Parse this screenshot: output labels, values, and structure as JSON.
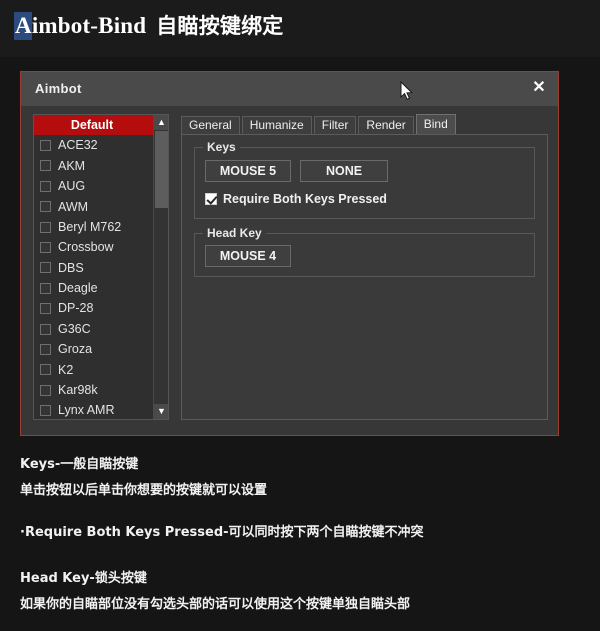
{
  "page": {
    "title_en_lead": "A",
    "title_en_rest": "imbot-Bind",
    "title_cn": "自瞄按键绑定"
  },
  "dialog": {
    "title": "Aimbot",
    "close_icon": "✕",
    "accent_border": "#9c3d34",
    "selected_color": "#b50d0d"
  },
  "weapon_list": {
    "scroll_up_icon": "▲",
    "scroll_down_icon": "▼",
    "items": [
      {
        "label": "Default",
        "selected": true,
        "checked": false
      },
      {
        "label": "ACE32",
        "selected": false,
        "checked": false
      },
      {
        "label": "AKM",
        "selected": false,
        "checked": false
      },
      {
        "label": "AUG",
        "selected": false,
        "checked": false
      },
      {
        "label": "AWM",
        "selected": false,
        "checked": false
      },
      {
        "label": "Beryl M762",
        "selected": false,
        "checked": false
      },
      {
        "label": "Crossbow",
        "selected": false,
        "checked": false
      },
      {
        "label": "DBS",
        "selected": false,
        "checked": false
      },
      {
        "label": "Deagle",
        "selected": false,
        "checked": false
      },
      {
        "label": "DP-28",
        "selected": false,
        "checked": false
      },
      {
        "label": "G36C",
        "selected": false,
        "checked": false
      },
      {
        "label": "Groza",
        "selected": false,
        "checked": false
      },
      {
        "label": "K2",
        "selected": false,
        "checked": false
      },
      {
        "label": "Kar98k",
        "selected": false,
        "checked": false
      },
      {
        "label": "Lynx AMR",
        "selected": false,
        "checked": false
      }
    ]
  },
  "tabs": [
    {
      "label": "General",
      "active": false
    },
    {
      "label": "Humanize",
      "active": false
    },
    {
      "label": "Filter",
      "active": false
    },
    {
      "label": "Render",
      "active": false
    },
    {
      "label": "Bind",
      "active": true
    }
  ],
  "keys_group": {
    "title": "Keys",
    "primary_key": "MOUSE 5",
    "secondary_key": "NONE",
    "require_both_label": "Require Both Keys Pressed",
    "require_both_checked": true
  },
  "head_key_group": {
    "title": "Head Key",
    "key": "MOUSE 4"
  },
  "notes": [
    {
      "text": "Keys-一般自瞄按键",
      "spacing": "none"
    },
    {
      "text": "单击按钮以后单击你想要的按键就可以设置",
      "spacing": "none"
    },
    {
      "text": "·Require Both Keys Pressed-可以同时按下两个自瞄按键不冲突",
      "spacing": "gap"
    },
    {
      "text": "Head Key-锁头按键",
      "spacing": "gap2"
    },
    {
      "text": "如果你的自瞄部位没有勾选头部的话可以使用这个按键单独自瞄头部",
      "spacing": "none"
    }
  ]
}
